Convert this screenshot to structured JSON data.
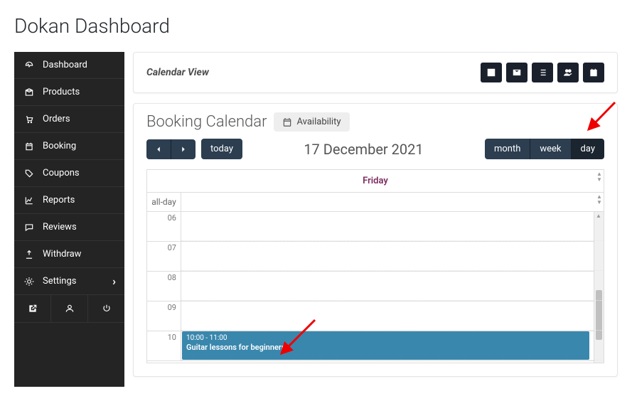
{
  "page_title": "Dokan Dashboard",
  "sidebar": {
    "items": [
      {
        "icon": "dashboard",
        "label": "Dashboard",
        "expandable": false
      },
      {
        "icon": "box",
        "label": "Products",
        "expandable": false
      },
      {
        "icon": "cart",
        "label": "Orders",
        "expandable": false
      },
      {
        "icon": "calendar",
        "label": "Booking",
        "expandable": false
      },
      {
        "icon": "tag",
        "label": "Coupons",
        "expandable": false
      },
      {
        "icon": "chart",
        "label": "Reports",
        "expandable": false
      },
      {
        "icon": "comment",
        "label": "Reviews",
        "expandable": false
      },
      {
        "icon": "upload",
        "label": "Withdraw",
        "expandable": false
      },
      {
        "icon": "gear",
        "label": "Settings",
        "expandable": true
      }
    ],
    "bottom_icons": [
      "external",
      "user",
      "power"
    ]
  },
  "panel_header": {
    "title": "Calendar View",
    "actions": [
      "edit",
      "mail",
      "list",
      "users",
      "calendar"
    ]
  },
  "calendar": {
    "heading": "Booking Calendar",
    "availability_label": "Availability",
    "date_title": "17 December 2021",
    "today_label": "today",
    "views": [
      {
        "label": "month",
        "active": false
      },
      {
        "label": "week",
        "active": false
      },
      {
        "label": "day",
        "active": true
      }
    ],
    "day_header": "Friday",
    "allday_label": "all-day",
    "hours": [
      "06",
      "07",
      "08",
      "09",
      "10"
    ],
    "events": [
      {
        "time": "10:00 - 11:00",
        "title": "Guitar lessons for beginners",
        "hour": "10"
      }
    ]
  }
}
